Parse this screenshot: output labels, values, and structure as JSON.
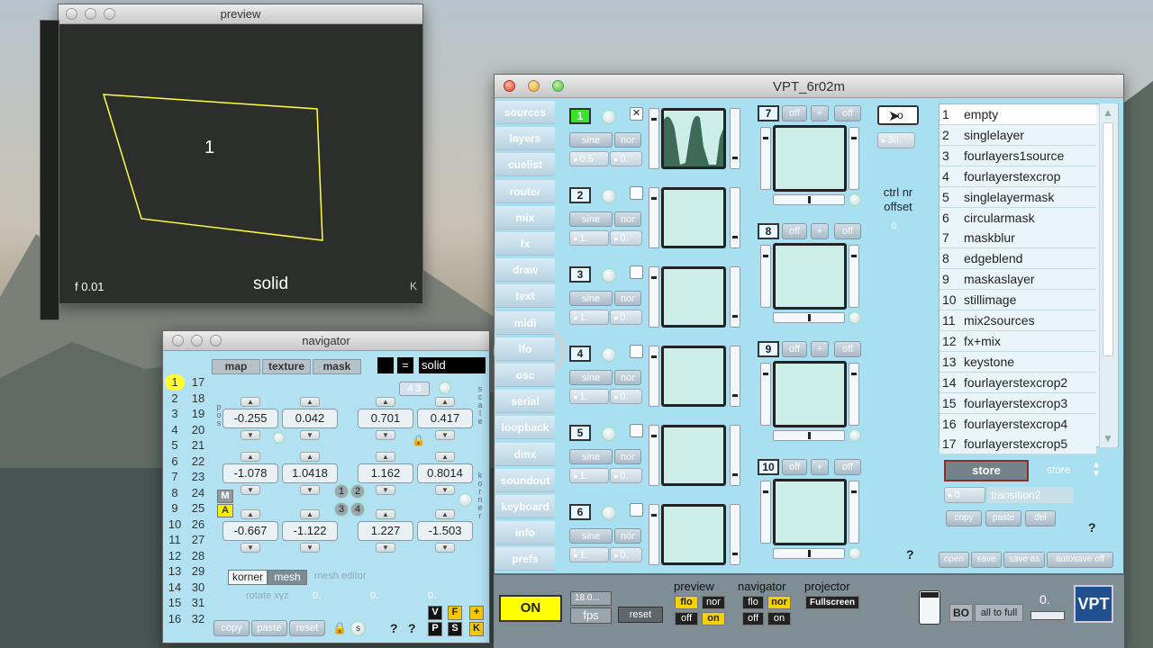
{
  "preview": {
    "title": "preview",
    "quad_label": "1",
    "left_readout": "f 0.01",
    "mode": "solid",
    "corner": "K",
    "quad_color": "#ffff3a"
  },
  "navigator": {
    "title": "navigator",
    "tabs": [
      "map",
      "texture",
      "mask"
    ],
    "equals": "=",
    "mode_value": "solid",
    "numbers_left": [
      "1",
      "2",
      "3",
      "4",
      "5",
      "6",
      "7",
      "8",
      "9",
      "10",
      "11",
      "12",
      "13",
      "14",
      "15",
      "16"
    ],
    "numbers_right": [
      "17",
      "18",
      "19",
      "20",
      "21",
      "22",
      "23",
      "24",
      "25",
      "26",
      "27",
      "28",
      "29",
      "30",
      "31",
      "32"
    ],
    "pos_label": "p o s",
    "scale_label": "s c a l e",
    "korner_label": "k o r n e r",
    "badge_43": "4 3",
    "row1": [
      "-0.255",
      "0.042",
      "0.701",
      "0.417"
    ],
    "row2": [
      "-1.078",
      "1.0418",
      "1.162",
      "0.8014"
    ],
    "row3": [
      "-0.667",
      "-1.122",
      "1.227",
      "-1.503"
    ],
    "m_label": "M",
    "a_label": "A",
    "corner_buttons": [
      "1",
      "2",
      "3",
      "4"
    ],
    "korner_btn": "korner",
    "mesh_btn": "mesh",
    "mesh_editor": "mesh editor",
    "rotate_label": "rotate xyz",
    "rotate_values": [
      "0.",
      "0.",
      "0."
    ],
    "bottom_buttons": [
      "copy",
      "paste",
      "reset"
    ],
    "s_label": "s",
    "q1": "?",
    "q2": "?",
    "v_btn": "V",
    "f_btn": "F",
    "plus_btn": "+",
    "p_btn": "P",
    "sbtn": "S",
    "k_btn": "K"
  },
  "vpt": {
    "title": "VPT_6r02m",
    "menu": [
      "sources",
      "layers",
      "cuelist",
      "router",
      "mix",
      "fx",
      "draw",
      "text",
      "midi",
      "lfo",
      "osc",
      "serial",
      "loopback",
      "dmx",
      "soundout",
      "keyboard",
      "info",
      "prefs"
    ],
    "layers": [
      {
        "num": "1",
        "b1": "sine",
        "b2": "nor",
        "v1": "0.5",
        "v2": "0."
      },
      {
        "num": "2",
        "b1": "sine",
        "b2": "nor",
        "v1": "1.",
        "v2": "0."
      },
      {
        "num": "3",
        "b1": "sine",
        "b2": "nor",
        "v1": "1.",
        "v2": "0."
      },
      {
        "num": "4",
        "b1": "sine",
        "b2": "nor",
        "v1": "1.",
        "v2": "0."
      },
      {
        "num": "5",
        "b1": "sine",
        "b2": "nor",
        "v1": "1.",
        "v2": "0."
      },
      {
        "num": "6",
        "b1": "sine",
        "b2": "nor",
        "v1": "1.",
        "v2": "0."
      }
    ],
    "close_x": "✕",
    "right_layers": [
      {
        "num": "7",
        "off1": "off",
        "plus": "+",
        "off2": "off"
      },
      {
        "num": "8",
        "off1": "off",
        "plus": "+",
        "off2": "off"
      },
      {
        "num": "9",
        "off1": "off",
        "plus": "+",
        "off2": "off"
      },
      {
        "num": "10",
        "off1": "off",
        "plus": "+",
        "off2": "off"
      }
    ],
    "cursor_field": "o",
    "rate_value": "30.",
    "ctrl_label": "ctrl nr",
    "offset_label": "offset",
    "offset_value": "0",
    "q_mid": "?",
    "presets": [
      {
        "n": "1",
        "name": "empty"
      },
      {
        "n": "2",
        "name": "singlelayer"
      },
      {
        "n": "3",
        "name": "fourlayers1source"
      },
      {
        "n": "4",
        "name": "fourlayerstexcrop"
      },
      {
        "n": "5",
        "name": "singlelayermask"
      },
      {
        "n": "6",
        "name": "circularmask"
      },
      {
        "n": "7",
        "name": "maskblur"
      },
      {
        "n": "8",
        "name": "edgeblend"
      },
      {
        "n": "9",
        "name": "maskaslayer"
      },
      {
        "n": "10",
        "name": "stillimage"
      },
      {
        "n": "11",
        "name": "mix2sources"
      },
      {
        "n": "12",
        "name": "fx+mix"
      },
      {
        "n": "13",
        "name": "keystone"
      },
      {
        "n": "14",
        "name": "fourlayerstexcrop2"
      },
      {
        "n": "15",
        "name": "fourlayerstexcrop3"
      },
      {
        "n": "16",
        "name": "fourlayerstexcrop4"
      },
      {
        "n": "17",
        "name": "fourlayerstexcrop5"
      }
    ],
    "store_btn": "store",
    "store_label": "store",
    "transition_value": "0",
    "transition_name": "transition2",
    "copy": "copy",
    "paste": "paste",
    "del": "del",
    "q_right": "?",
    "file_buttons": [
      "open",
      "save",
      "save as",
      "autosave off"
    ],
    "bottom": {
      "on": "ON",
      "fps_value": "18.0...",
      "fps_label": "fps",
      "reset": "reset",
      "preview_label": "preview",
      "navigator_label": "navigator",
      "projector_label": "projector",
      "flo": "flo",
      "nor": "nor",
      "off": "off",
      "on_small": "on",
      "fullscreen": "Fullscreen",
      "bo": "BO",
      "all_to_full": "all to full",
      "level": "0.",
      "logo": "VPT"
    },
    "accent_green": "#36e42a",
    "accent_yellow": "#ffff00"
  }
}
